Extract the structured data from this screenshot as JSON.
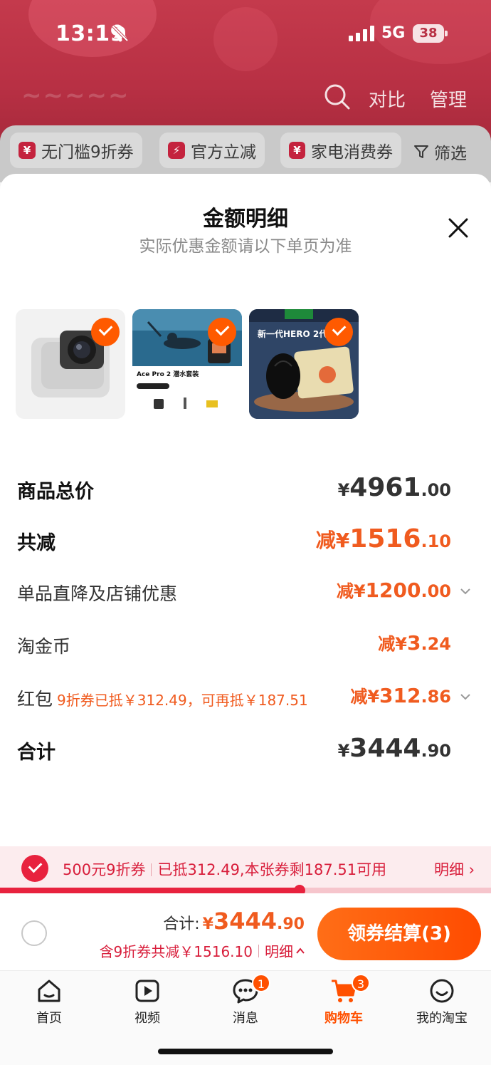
{
  "status_bar": {
    "time": "13:19",
    "network": "5G",
    "battery": "38"
  },
  "header": {
    "compare": "对比",
    "manage": "管理"
  },
  "filters": {
    "chips": [
      "无门槛9折券",
      "官方立减",
      "家电消费券"
    ],
    "filter_label": "筛选"
  },
  "sheet": {
    "title": "金额明细",
    "subtitle": "实际优惠金额请以下单页为准",
    "thumb2_caption": "Ace Pro 2 潜水套装",
    "thumb3_caption": "新一代HERO 2代"
  },
  "rows": {
    "total_price": {
      "label": "商品总价",
      "prefix": "¥",
      "int": "4961",
      "dec": ".00"
    },
    "total_discount": {
      "label": "共减",
      "prefix": "减¥",
      "int": "1516",
      "dec": ".10"
    },
    "item_discount": {
      "label": "单品直降及店铺优惠",
      "prefix": "减¥",
      "int": "1200",
      "dec": ".00"
    },
    "coins": {
      "label": "淘金币",
      "prefix": "减¥",
      "int": "3",
      "dec": ".24"
    },
    "red_packet": {
      "label": "红包",
      "note": "9折券已抵￥312.49，可再抵￥187.51",
      "prefix": "减¥",
      "int": "312",
      "dec": ".86"
    },
    "sum": {
      "label": "合计",
      "prefix": "¥",
      "int": "3444",
      "dec": ".90"
    }
  },
  "coupon": {
    "name": "500元9折券",
    "info": "已抵312.49,本张券剩187.51可用",
    "detail": "明细",
    "progress": 0.61
  },
  "checkout": {
    "total_label": "合计:",
    "total_prefix": "¥",
    "total_int": "3444",
    "total_dec": ".90",
    "saving": "含9折券共减￥1516.10",
    "detail": "明细",
    "button": "领券结算(3)"
  },
  "tabs": [
    {
      "label": "首页"
    },
    {
      "label": "视频"
    },
    {
      "label": "消息",
      "badge": "1"
    },
    {
      "label": "购物车",
      "badge": "3"
    },
    {
      "label": "我的淘宝"
    }
  ],
  "colors": {
    "accent": "#ff5000",
    "discount": "#f05b1f",
    "brand_red": "#e8223e"
  }
}
